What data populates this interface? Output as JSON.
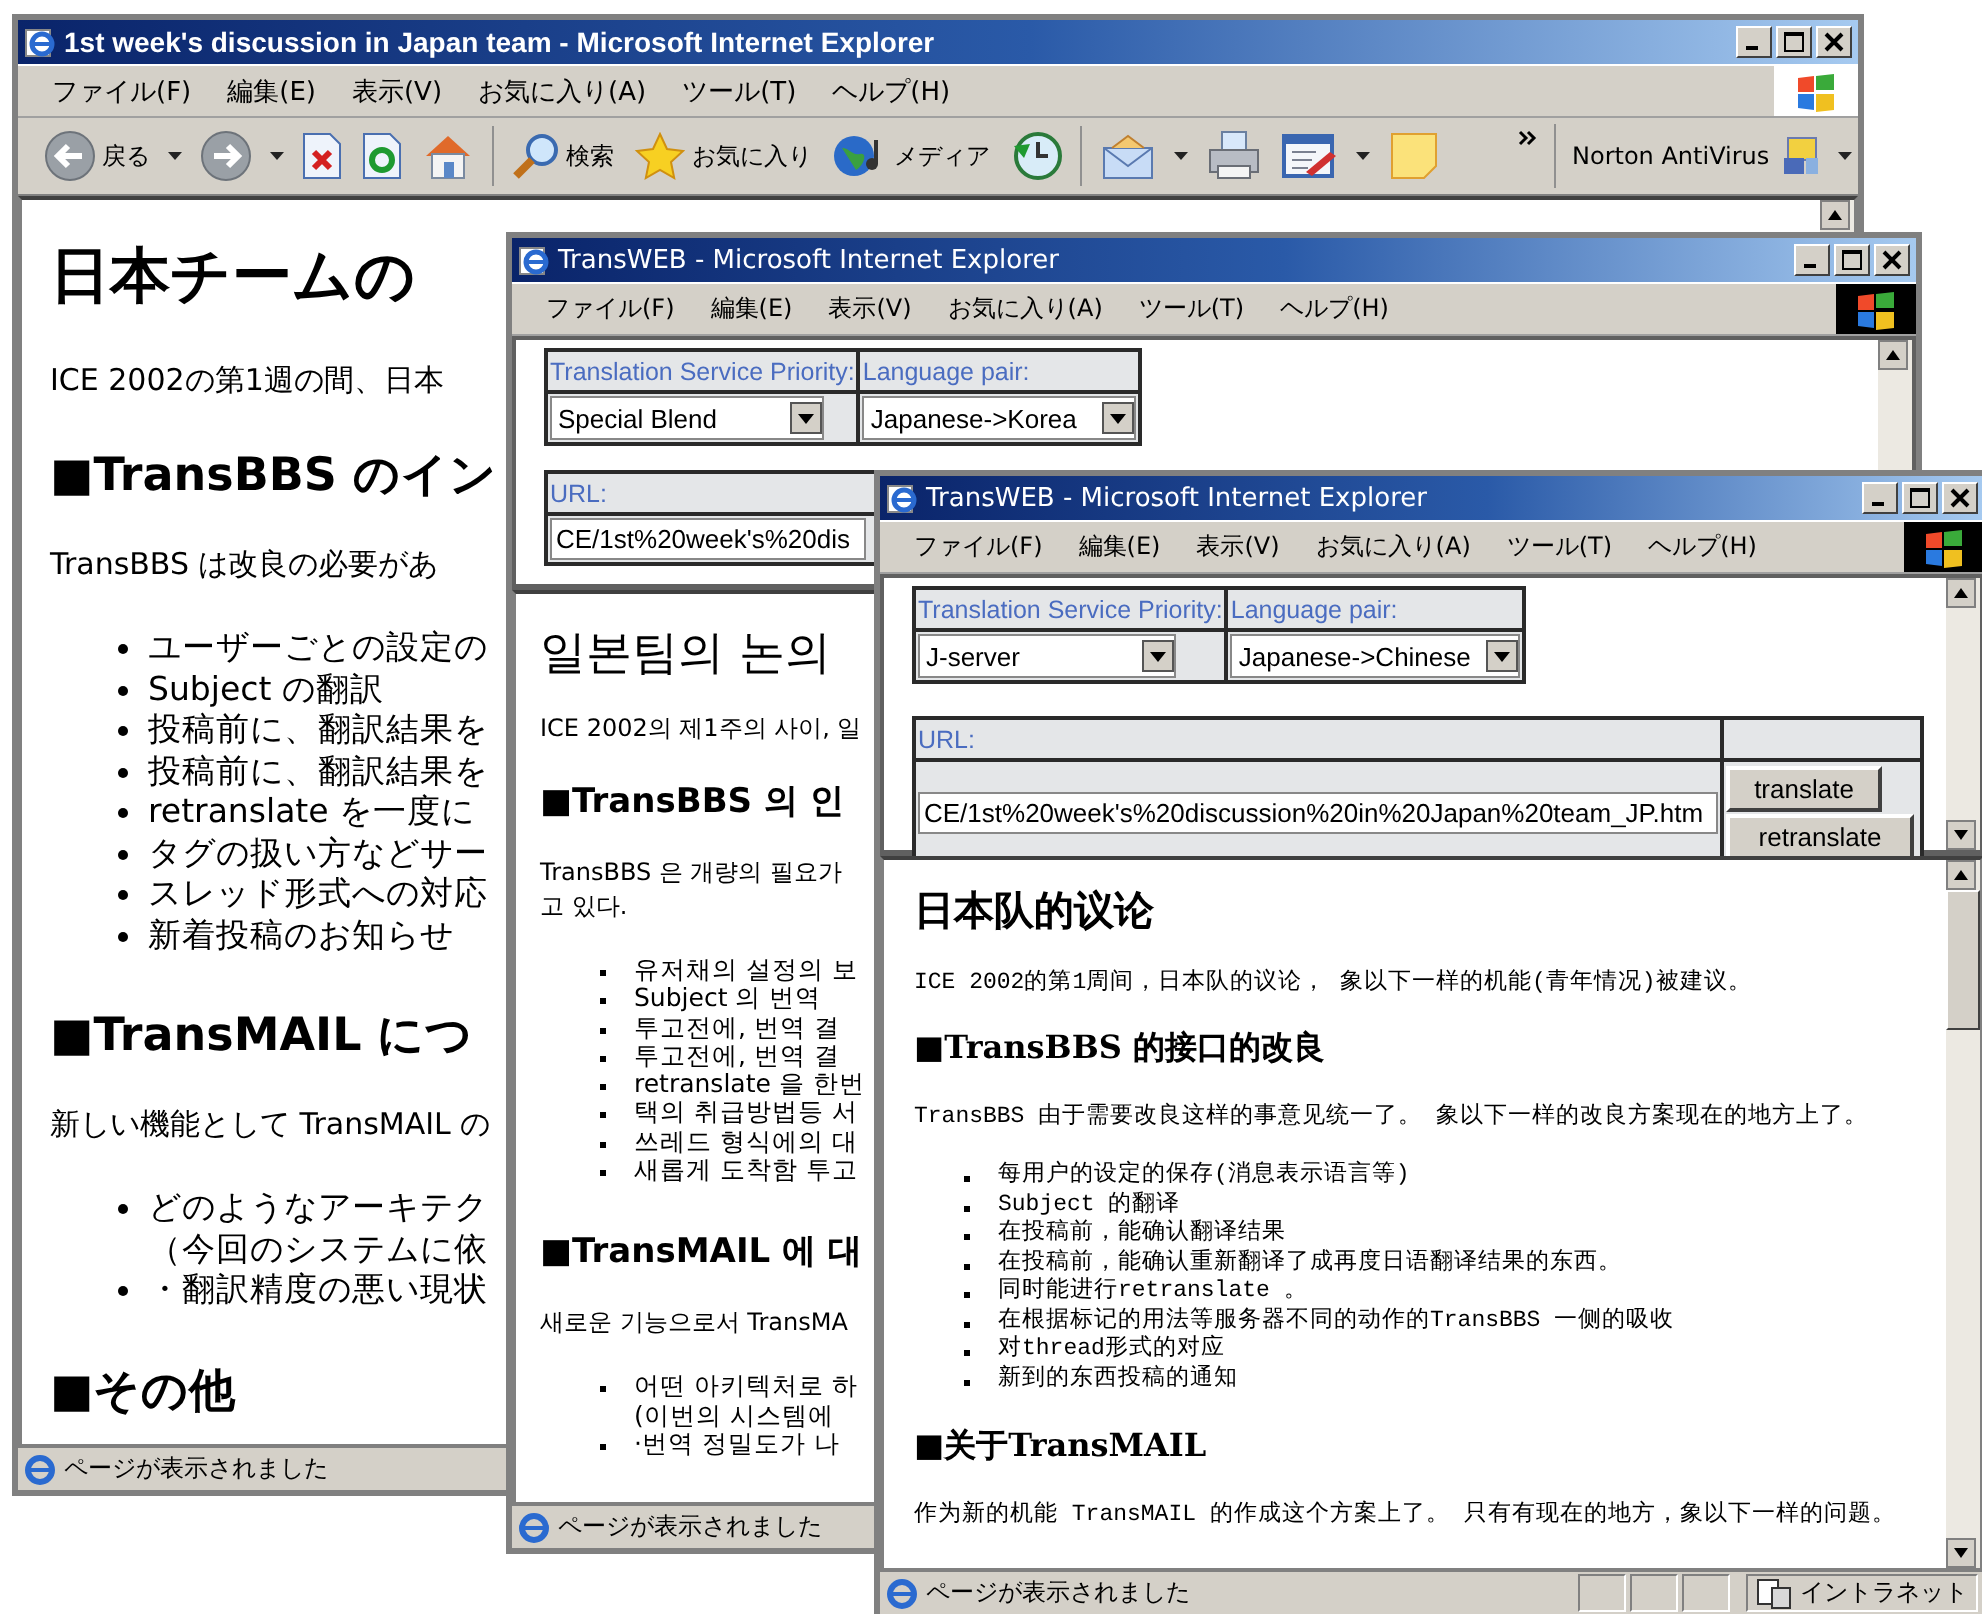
{
  "windows": [
    {
      "title": "1st week's discussion in Japan team - Microsoft Internet Explorer",
      "menu": [
        "ファイル(F)",
        "編集(E)",
        "表示(V)",
        "お気に入り(A)",
        "ツール(T)",
        "ヘルプ(H)"
      ],
      "toolbar_groups": [
        {
          "items": [
            {
              "kind": "back",
              "label": "戻る",
              "dropdown": true
            },
            {
              "kind": "forward",
              "dropdown": true
            },
            {
              "kind": "stop",
              "dropdown": false
            },
            {
              "kind": "refresh",
              "dropdown": false
            },
            {
              "kind": "home",
              "dropdown": false
            }
          ]
        },
        {
          "items": [
            {
              "kind": "search",
              "label": "検索",
              "dropdown": false
            },
            {
              "kind": "favorites",
              "label": "お気に入り",
              "dropdown": false
            },
            {
              "kind": "media",
              "label": "メディア",
              "dropdown": false
            },
            {
              "kind": "history",
              "dropdown": false
            }
          ]
        },
        {
          "items": [
            {
              "kind": "mail",
              "dropdown": true
            },
            {
              "kind": "print",
              "dropdown": false
            },
            {
              "kind": "edit",
              "dropdown": true
            },
            {
              "kind": "note",
              "dropdown": false
            }
          ]
        }
      ],
      "addon": {
        "label": "Norton AntiVirus"
      },
      "content": [
        {
          "kind": "heading1",
          "text": "日本チームの"
        },
        {
          "kind": "paragraph",
          "lines": [
            "ICE 2002の第1週の間、日本"
          ]
        },
        {
          "kind": "heading2",
          "text": "■TransBBS のイン"
        },
        {
          "kind": "paragraph",
          "lines": [
            "TransBBS は改良の必要があ"
          ]
        },
        {
          "kind": "list",
          "items": [
            {
              "lines": [
                "ユーザーごとの設定の"
              ]
            },
            {
              "lines": [
                "Subject の翻訳"
              ]
            },
            {
              "lines": [
                "投稿前に、翻訳結果を"
              ]
            },
            {
              "lines": [
                "投稿前に、翻訳結果を"
              ]
            },
            {
              "lines": [
                "retranslate を一度に"
              ]
            },
            {
              "lines": [
                "タグの扱い方などサー"
              ]
            },
            {
              "lines": [
                "スレッド形式への対応"
              ]
            },
            {
              "lines": [
                "新着投稿のお知らせ"
              ]
            }
          ]
        },
        {
          "kind": "heading2",
          "text": "■TransMAIL につ"
        },
        {
          "kind": "paragraph",
          "lines": [
            "新しい機能として TransMAIL の"
          ]
        },
        {
          "kind": "list",
          "items": [
            {
              "lines": [
                "どのようなアーキテク",
                "（今回のシステムに依"
              ]
            },
            {
              "lines": [
                "・翻訳精度の悪い現状"
              ]
            }
          ]
        },
        {
          "kind": "heading2",
          "text": "■その他"
        }
      ],
      "status": "ページが表示されました"
    },
    {
      "title": "TransWEB - Microsoft Internet Explorer",
      "menu": [
        "ファイル(F)",
        "編集(E)",
        "表示(V)",
        "お気に入り(A)",
        "ツール(T)",
        "ヘルプ(H)"
      ],
      "form": {
        "priority_label": "Translation Service Priority:",
        "language_label": "Language pair:",
        "priority_value": "Special Blend",
        "language_value": "Japanese->Korea",
        "url_label": "URL:",
        "url_value": "CE/1st%20week's%20dis"
      },
      "content": [
        {
          "kind": "heading1",
          "text": "일본팀의 논의"
        },
        {
          "kind": "paragraph",
          "lines": [
            "ICE 2002의 제1주의 사이, 일"
          ]
        },
        {
          "kind": "heading2",
          "text": "■TransBBS 의 인"
        },
        {
          "kind": "paragraph",
          "lines": [
            "TransBBS 은 개량의 필요가",
            "고 있다."
          ]
        },
        {
          "kind": "list",
          "items": [
            {
              "lines": [
                "유저채의 설정의 보"
              ]
            },
            {
              "lines": [
                "Subject 의 번역"
              ]
            },
            {
              "lines": [
                "투고전에, 번역 결"
              ]
            },
            {
              "lines": [
                "투고전에, 번역 결"
              ]
            },
            {
              "lines": [
                "retranslate 을 한번"
              ]
            },
            {
              "lines": [
                "택의 취급방법등 서"
              ]
            },
            {
              "lines": [
                "쓰레드 형식에의 대"
              ]
            },
            {
              "lines": [
                "새롭게 도착함 투고"
              ]
            }
          ]
        },
        {
          "kind": "heading2",
          "text": "■TransMAIL 에 대"
        },
        {
          "kind": "paragraph",
          "lines": [
            "새로운 기능으로서 TransMA"
          ]
        },
        {
          "kind": "list",
          "items": [
            {
              "lines": [
                "어떤 아키텍처로 하",
                "(이번의 시스템에"
              ]
            },
            {
              "lines": [
                "·번역 정밀도가 나"
              ]
            }
          ]
        }
      ],
      "status": "ページが表示されました"
    },
    {
      "title": "TransWEB - Microsoft Internet Explorer",
      "menu": [
        "ファイル(F)",
        "編集(E)",
        "表示(V)",
        "お気に入り(A)",
        "ツール(T)",
        "ヘルプ(H)"
      ],
      "form": {
        "priority_label": "Translation Service Priority:",
        "language_label": "Language pair:",
        "priority_value": "J-server",
        "language_value": "Japanese->Chinese",
        "url_label": "URL:",
        "url_value": "CE/1st%20week's%20discussion%20in%20Japan%20team_JP.htm",
        "buttons": [
          "translate",
          "retranslate"
        ]
      },
      "content": [
        {
          "kind": "heading1",
          "text": "日本队的议论"
        },
        {
          "kind": "paragraph",
          "lines": [
            "ICE 2002的第1周间，日本队的议论， 象以下一样的机能(青年情况)被建议。"
          ]
        },
        {
          "kind": "heading2",
          "text": "■TransBBS 的接口的改良"
        },
        {
          "kind": "paragraph",
          "lines": [
            "TransBBS 由于需要改良这样的事意见统一了。 象以下一样的改良方案现在的地方上了。"
          ]
        },
        {
          "kind": "list",
          "items": [
            {
              "lines": [
                "每用户的设定的保存(消息表示语言等)"
              ]
            },
            {
              "lines": [
                "Subject 的翻译"
              ]
            },
            {
              "lines": [
                "在投稿前，能确认翻译结果"
              ]
            },
            {
              "lines": [
                "在投稿前，能确认重新翻译了成再度日语翻译结果的东西。"
              ]
            },
            {
              "lines": [
                "同时能进行retranslate 。"
              ]
            },
            {
              "lines": [
                "在根据标记的用法等服务器不同的动作的TransBBS 一侧的吸收"
              ]
            },
            {
              "lines": [
                "对thread形式的对应"
              ]
            },
            {
              "lines": [
                "新到的东西投稿的通知"
              ]
            }
          ]
        },
        {
          "kind": "heading2",
          "text": "■关于TransMAIL"
        },
        {
          "kind": "paragraph",
          "lines": [
            "作为新的机能 TransMAIL 的作成这个方案上了。 只有有现在的地方，象以下一样的问题。"
          ]
        }
      ],
      "status": "ページが表示されました",
      "zone": "イントラネット"
    }
  ]
}
